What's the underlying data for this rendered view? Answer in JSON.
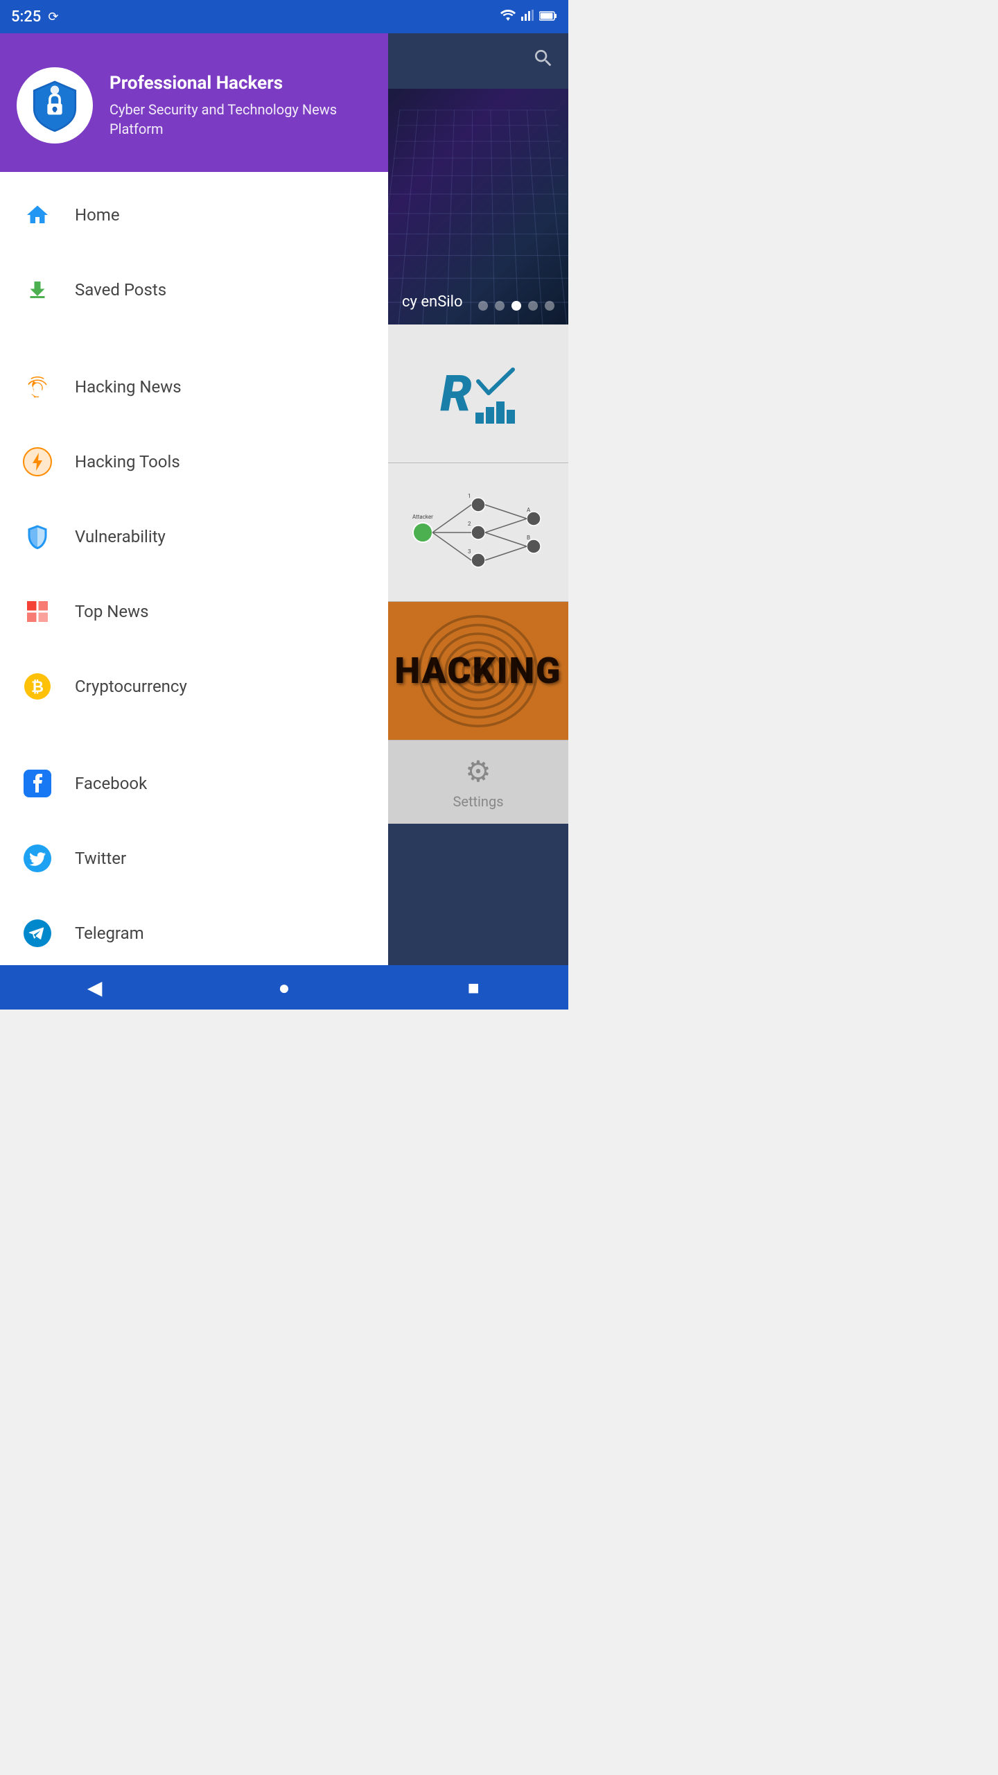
{
  "statusBar": {
    "time": "5:25",
    "wifiIcon": "▼",
    "signalIcon": "▲",
    "batteryIcon": "▮"
  },
  "sidebar": {
    "appName": "Professional Hackers",
    "appSubtitle": "Cyber Security and Technology News Platform",
    "navItems": [
      {
        "id": "home",
        "label": "Home",
        "icon": "home",
        "iconColor": "blue",
        "section": "main"
      },
      {
        "id": "saved-posts",
        "label": "Saved Posts",
        "icon": "download",
        "iconColor": "green",
        "section": "main"
      },
      {
        "id": "hacking-news",
        "label": "Hacking News",
        "icon": "fingerprint",
        "iconColor": "orange-gold",
        "section": "categories"
      },
      {
        "id": "hacking-tools",
        "label": "Hacking Tools",
        "icon": "lightning",
        "iconColor": "orange-gold",
        "section": "categories"
      },
      {
        "id": "vulnerability",
        "label": "Vulnerability",
        "icon": "shield",
        "iconColor": "blue",
        "section": "categories"
      },
      {
        "id": "top-news",
        "label": "Top News",
        "icon": "grid",
        "iconColor": "red",
        "section": "categories"
      },
      {
        "id": "cryptocurrency",
        "label": "Cryptocurrency",
        "icon": "bitcoin",
        "iconColor": "yellow",
        "section": "categories"
      },
      {
        "id": "facebook",
        "label": "Facebook",
        "icon": "facebook",
        "iconColor": "facebook",
        "section": "social"
      },
      {
        "id": "twitter",
        "label": "Twitter",
        "icon": "twitter",
        "iconColor": "twitter",
        "section": "social"
      },
      {
        "id": "telegram",
        "label": "Telegram",
        "icon": "telegram",
        "iconColor": "telegram",
        "section": "social"
      }
    ]
  },
  "content": {
    "heroLabel": "cy enSilo",
    "heroDots": [
      0,
      1,
      2,
      3,
      4
    ],
    "activeHeroDot": 2,
    "cards": [
      {
        "type": "rt-logo",
        "alt": "RT Logo"
      },
      {
        "type": "network-diagram",
        "alt": "Network Diagram"
      },
      {
        "type": "hacking-image",
        "alt": "Hacking",
        "text": "HACKING"
      }
    ],
    "settings": {
      "label": "Settings"
    }
  },
  "bottomNav": {
    "backLabel": "◀",
    "homeLabel": "●",
    "squareLabel": "■"
  }
}
